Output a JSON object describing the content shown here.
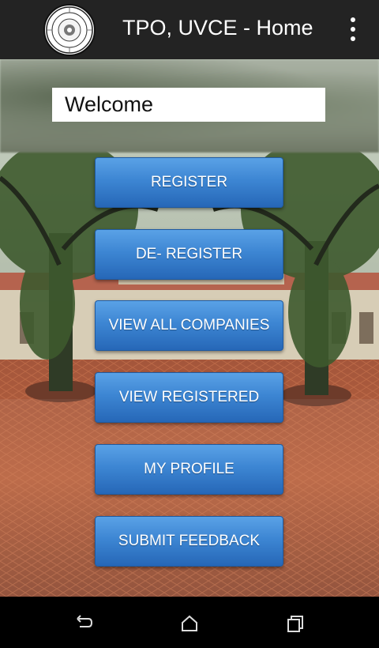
{
  "app_bar": {
    "title": "TPO, UVCE - Home",
    "logo_icon": "college-seal-icon",
    "menu_icon": "overflow-menu-icon"
  },
  "welcome": {
    "value": "Welcome"
  },
  "buttons": [
    {
      "label": "REGISTER"
    },
    {
      "label": "DE- REGISTER"
    },
    {
      "label": "VIEW ALL COMPANIES"
    },
    {
      "label": "VIEW REGISTERED"
    },
    {
      "label": "MY PROFILE"
    },
    {
      "label": "SUBMIT FEEDBACK"
    }
  ],
  "nav_bar": {
    "back_icon": "back-icon",
    "home_icon": "home-icon",
    "recents_icon": "recents-icon"
  },
  "colors": {
    "app_bar": "#232323",
    "button_blue": "#3d86d3",
    "nav_bar": "#000000"
  }
}
